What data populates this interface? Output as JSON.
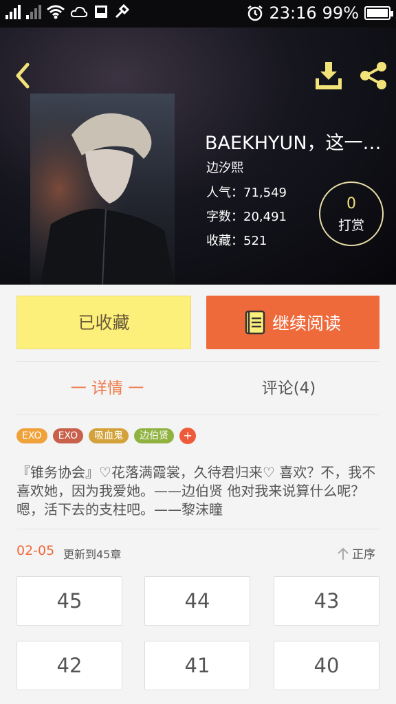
{
  "status": {
    "time": "23:16",
    "battery": "99%",
    "battery_level": 0.99
  },
  "book": {
    "title": "BAEKHYUN，这一…",
    "author": "边汐熙",
    "popularity_label": "人气：",
    "popularity": "71,549",
    "words_label": "字数：",
    "words": "20,491",
    "favorites_label": "收藏：",
    "favorites": "521",
    "reward_count": "0",
    "reward_label": "打赏"
  },
  "actions": {
    "favorited_label": "已收藏",
    "continue_label": "继续阅读"
  },
  "tabs": {
    "detail": "一 详情 一",
    "comments": "评论(4)"
  },
  "tags": [
    {
      "label": "EXO",
      "color": "#f0a23a"
    },
    {
      "label": "EXO",
      "color": "#c8604c"
    },
    {
      "label": "吸血鬼",
      "color": "#d3a23a"
    },
    {
      "label": "边伯贤",
      "color": "#8fb241"
    },
    {
      "label": "+",
      "color": "#ef5b3a"
    }
  ],
  "description": "『锥务协会』♡花落满霞裳，久待君归来♡ 喜欢？不，我不喜欢她，因为我爱她。——边伯贤 他对我来说算什么呢？嗯，活下去的支柱吧。——黎沫瞳",
  "update": {
    "date": "02-05",
    "text": "更新到45章",
    "order_label": "正序"
  },
  "chapters": [
    "45",
    "44",
    "43",
    "42",
    "41",
    "40"
  ],
  "icons": {
    "back": "back-arrow-icon",
    "download": "download-icon",
    "share": "share-icon",
    "book": "book-icon",
    "sort": "sort-up-icon",
    "alarm": "alarm-icon",
    "wifi": "wifi-icon"
  },
  "colors": {
    "accent_orange": "#ef6a3a",
    "accent_yellow": "#fdf07a",
    "hero_icon": "#f2e27a"
  }
}
